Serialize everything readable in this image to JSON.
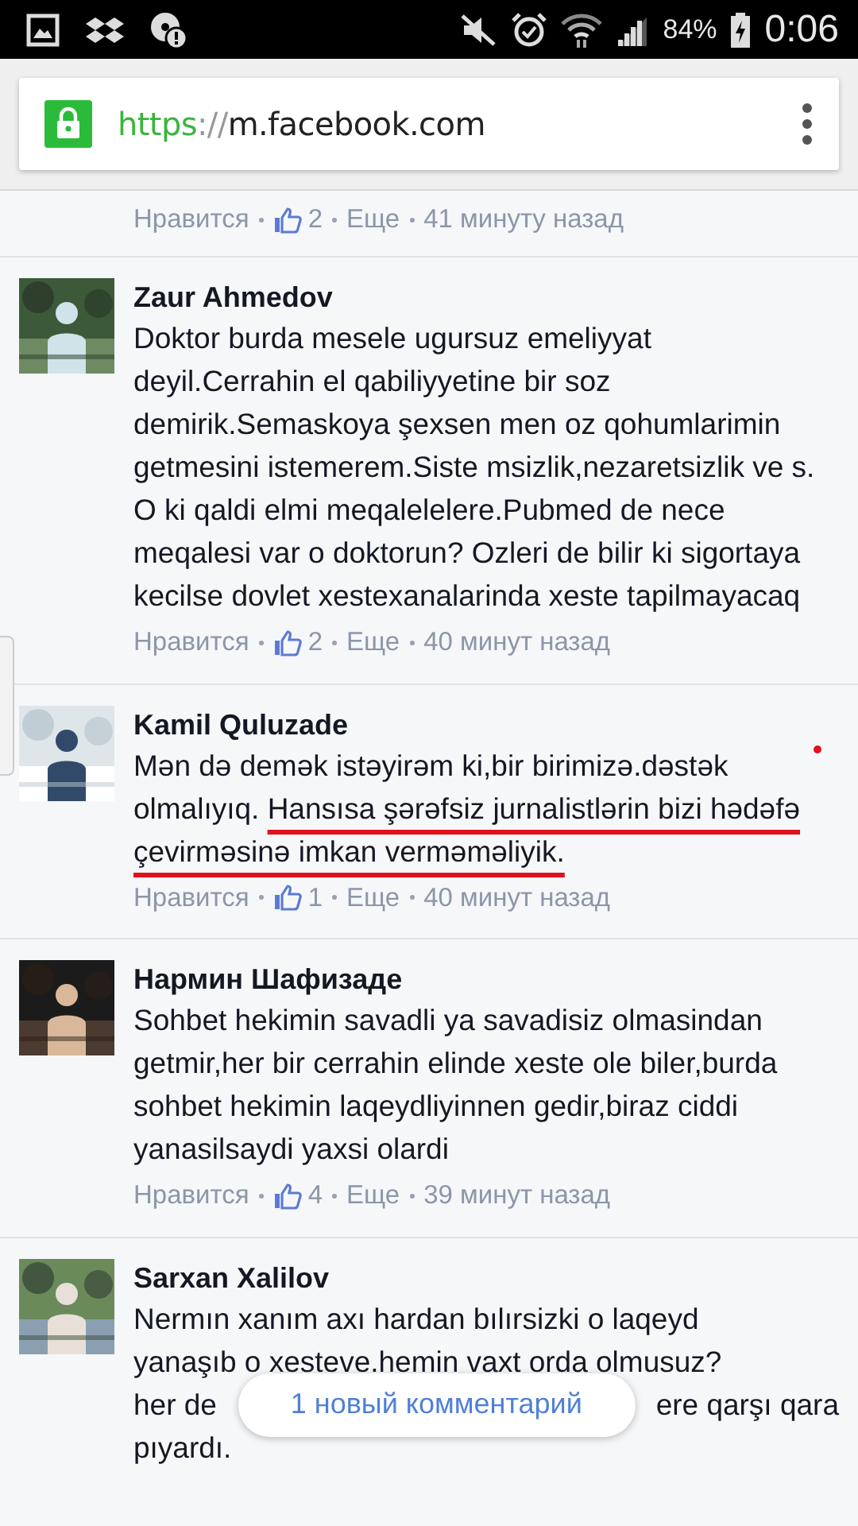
{
  "status_bar": {
    "battery": "84%",
    "time": "0:06"
  },
  "address_bar": {
    "scheme": "https",
    "separator": "://",
    "host": "m.facebook.com"
  },
  "top_footer": {
    "like": "Нравится",
    "likes": "2",
    "more": "Еще",
    "time": "41 минуту назад"
  },
  "comments": [
    {
      "kind": "text",
      "author": "Zaur Ahmedov",
      "body": "Doktor burda mesele ugursuz emeliyyat deyil.Cerrahin el qabiliyyetine bir soz demirik.Semaskoya şexsen men oz qohumlarimin getmesini istemerem.Siste msizlik,nezaretsizlik ve s. O ki qaldi elmi meqalelelere.Pubmed de nece meqalesi var o doktorun? Ozleri de bilir ki sigortaya kecilse dovlet xestexanalarinda xeste tapilmayacaq",
      "footer": {
        "like": "Нравится",
        "likes": "2",
        "more": "Еще",
        "time": "40 минут назад"
      }
    },
    {
      "kind": "text",
      "author": "Kamil Quluzade",
      "body": "Mən də demək istəyirəm ki,bir birimizə.dəstək olmalıyıq.",
      "annotated_text": "Hansısa şərəfsiz jurnalistlərin bizi hədəfə çevirməsinə imkan verməməliyik.",
      "footer": {
        "like": "Нравится",
        "likes": "1",
        "more": "Еще",
        "time": "40 минут назад"
      }
    },
    {
      "kind": "text",
      "author": "Нармин Шафизаде",
      "body": "Sohbet hekimin savadli ya savadisiz olmasindan getmir,her bir cerrahin elinde xeste ole biler,burda sohbet hekimin laqeydliyinnen gedir,biraz ciddi yanasilsaydi yaxsi olardi",
      "footer": {
        "like": "Нравится",
        "likes": "4",
        "more": "Еще",
        "time": "39 минут назад"
      }
    },
    {
      "kind": "lines",
      "author": "Sarxan Xalilov",
      "lines": [
        [
          "Nermın xanım axı hardan bılırsizki o laqeyd"
        ],
        [
          "yanaşıb o xesteve.hemin vaxt orda olmusuz?"
        ],
        [
          "her de",
          "ere qarşı qara"
        ],
        [
          "pıyardı."
        ]
      ]
    }
  ],
  "new_comments_pill": "1 новый комментарий"
}
